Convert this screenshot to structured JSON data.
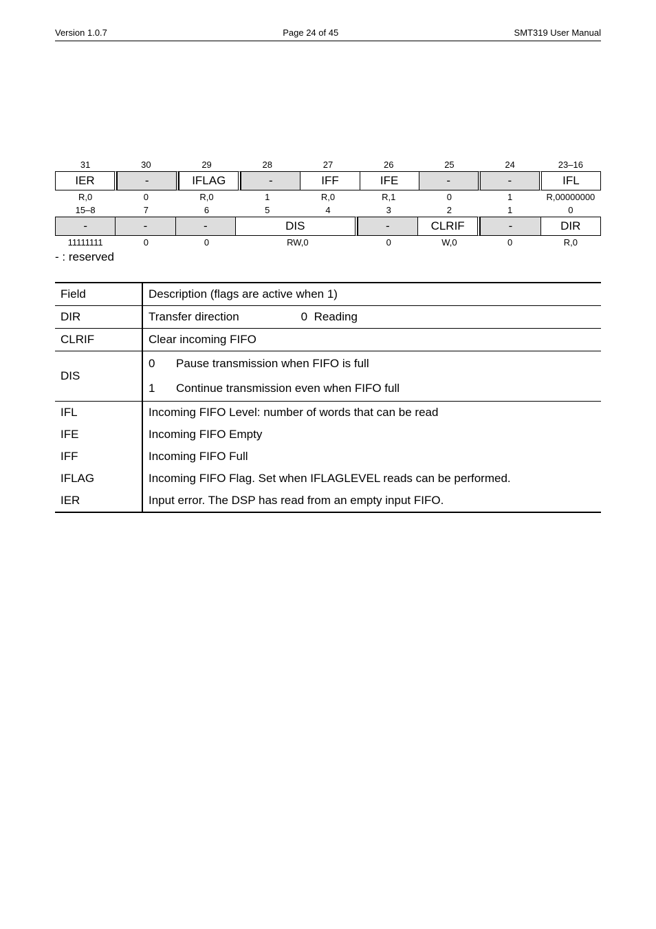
{
  "header": {
    "left": "Version 1.0.7",
    "center": "Page 24 of 45",
    "right": "SMT319 User Manual"
  },
  "regrow1": {
    "bits": [
      "31",
      "30",
      "29",
      "28",
      "27",
      "26",
      "25",
      "24",
      "23–16"
    ],
    "names": [
      "IER",
      "-",
      "IFLAG",
      "-",
      "IFF",
      "IFE",
      "-",
      "-",
      "IFL"
    ],
    "gray": [
      false,
      true,
      false,
      true,
      false,
      false,
      true,
      true,
      false
    ],
    "vals": [
      "R,0",
      "0",
      "R,0",
      "1",
      "R,0",
      "R,1",
      "0",
      "1",
      "R,00000000"
    ]
  },
  "regrow2": {
    "bits": [
      "15–8",
      "7",
      "6",
      "5",
      "4",
      "3",
      "2",
      "1",
      "0"
    ],
    "names": [
      "-",
      "-",
      "-",
      "DIS",
      "",
      "-",
      "CLRIF",
      "-",
      "DIR"
    ],
    "gray": [
      true,
      true,
      true,
      false,
      false,
      true,
      false,
      true,
      false
    ],
    "vals": [
      "11111111",
      "0",
      "0",
      "RW,0",
      "",
      "0",
      "W,0",
      "0",
      "R,0"
    ]
  },
  "reserved_label": "- : reserved",
  "field_header": {
    "c1": "Field",
    "c2": "Description (flags are active when 1)"
  },
  "dir": {
    "name": "DIR",
    "desc": "Transfer direction",
    "code": "0",
    "val": "Reading"
  },
  "clrif": {
    "name": "CLRIF",
    "desc": "Clear incoming FIFO"
  },
  "dis": {
    "name": "DIS",
    "l0n": "0",
    "l0": "Pause transmission when FIFO is full",
    "l1n": "1",
    "l1": "Continue transmission even when FIFO full"
  },
  "ifl": {
    "name": "IFL",
    "desc": "Incoming FIFO Level: number of words that can be read"
  },
  "ife": {
    "name": "IFE",
    "desc": "Incoming FIFO Empty"
  },
  "iff": {
    "name": "IFF",
    "desc": "Incoming FIFO Full"
  },
  "iflag": {
    "name": "IFLAG",
    "desc": "Incoming FIFO Flag. Set when IFLAGLEVEL reads can be performed."
  },
  "ier": {
    "name": "IER",
    "desc": "Input error. The DSP has read from an empty input FIFO."
  }
}
